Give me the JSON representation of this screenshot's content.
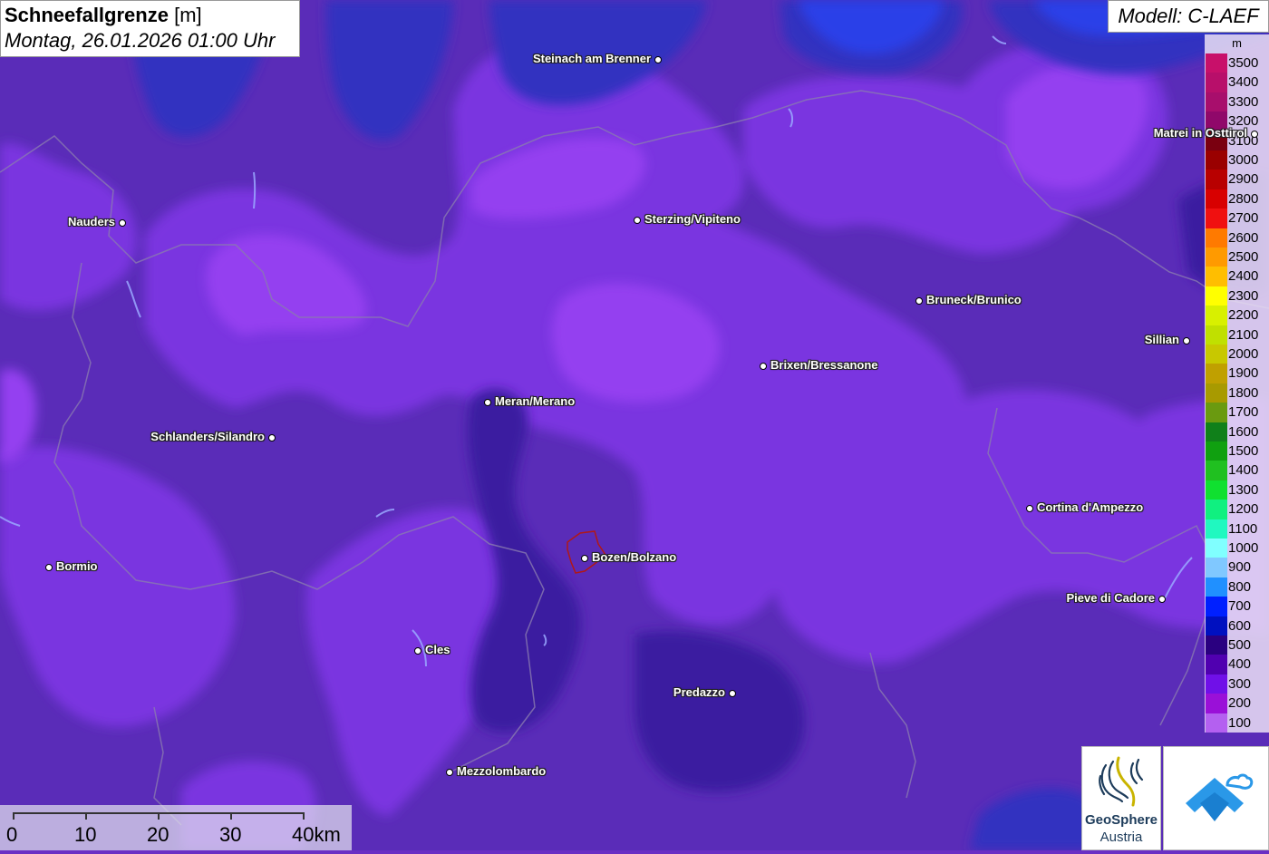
{
  "title": {
    "main": "Schneefallgrenze",
    "unit": "[m]",
    "datetime": "Montag, 26.01.2026 01:00 Uhr"
  },
  "model": "Modell: C-LAEF",
  "legend": {
    "unit": "m",
    "items": [
      {
        "label": "3500",
        "color": "#c8106a"
      },
      {
        "label": "3400",
        "color": "#b80f6a"
      },
      {
        "label": "3300",
        "color": "#a80e6c"
      },
      {
        "label": "3200",
        "color": "#90086a"
      },
      {
        "label": "3100",
        "color": "#7a0010"
      },
      {
        "label": "3000",
        "color": "#9a0000"
      },
      {
        "label": "2900",
        "color": "#b80000"
      },
      {
        "label": "2800",
        "color": "#d80000"
      },
      {
        "label": "2700",
        "color": "#f01010"
      },
      {
        "label": "2600",
        "color": "#ff7a00"
      },
      {
        "label": "2500",
        "color": "#ff9a00"
      },
      {
        "label": "2400",
        "color": "#ffbe00"
      },
      {
        "label": "2300",
        "color": "#ffff00"
      },
      {
        "label": "2200",
        "color": "#d8f000"
      },
      {
        "label": "2100",
        "color": "#c0e000"
      },
      {
        "label": "2000",
        "color": "#c8c800"
      },
      {
        "label": "1900",
        "color": "#c0a000"
      },
      {
        "label": "1800",
        "color": "#a89a00"
      },
      {
        "label": "1700",
        "color": "#6a9a10"
      },
      {
        "label": "1600",
        "color": "#10801a"
      },
      {
        "label": "1500",
        "color": "#10a010"
      },
      {
        "label": "1400",
        "color": "#20c020"
      },
      {
        "label": "1300",
        "color": "#10e030"
      },
      {
        "label": "1200",
        "color": "#10f080"
      },
      {
        "label": "1100",
        "color": "#20f8c0"
      },
      {
        "label": "1000",
        "color": "#80ffff"
      },
      {
        "label": "900",
        "color": "#80c8ff"
      },
      {
        "label": "800",
        "color": "#2090ff"
      },
      {
        "label": "700",
        "color": "#0020ff"
      },
      {
        "label": "600",
        "color": "#0010c0"
      },
      {
        "label": "500",
        "color": "#2a0080"
      },
      {
        "label": "400",
        "color": "#5000b0"
      },
      {
        "label": "300",
        "color": "#7010e8"
      },
      {
        "label": "200",
        "color": "#9a10d8"
      },
      {
        "label": "100",
        "color": "#b460f0"
      }
    ]
  },
  "cities": [
    {
      "name": "Steinach am Brenner",
      "side": "left"
    },
    {
      "name": "Nauders",
      "side": "left"
    },
    {
      "name": "Sterzing/Vipiteno",
      "side": "right"
    },
    {
      "name": "Matrei in Osttirol",
      "side": "left"
    },
    {
      "name": "Bruneck/Brunico",
      "side": "right"
    },
    {
      "name": "Sillian",
      "side": "left"
    },
    {
      "name": "Brixen/Bressanone",
      "side": "right"
    },
    {
      "name": "Meran/Merano",
      "side": "right"
    },
    {
      "name": "Schlanders/Silandro",
      "side": "left"
    },
    {
      "name": "Cortina d'Ampezzo",
      "side": "right"
    },
    {
      "name": "Bormio",
      "side": "right"
    },
    {
      "name": "Bozen/Bolzano",
      "side": "right"
    },
    {
      "name": "Pieve di Cadore",
      "side": "left"
    },
    {
      "name": "Cles",
      "side": "right"
    },
    {
      "name": "Predazzo",
      "side": "left"
    },
    {
      "name": "Mezzolombardo",
      "side": "right"
    }
  ],
  "scale": {
    "labels": [
      "0",
      "10",
      "20",
      "30",
      "40km"
    ]
  },
  "logos": {
    "geosphere_name": "GeoSphere",
    "geosphere_sub": "Austria"
  }
}
